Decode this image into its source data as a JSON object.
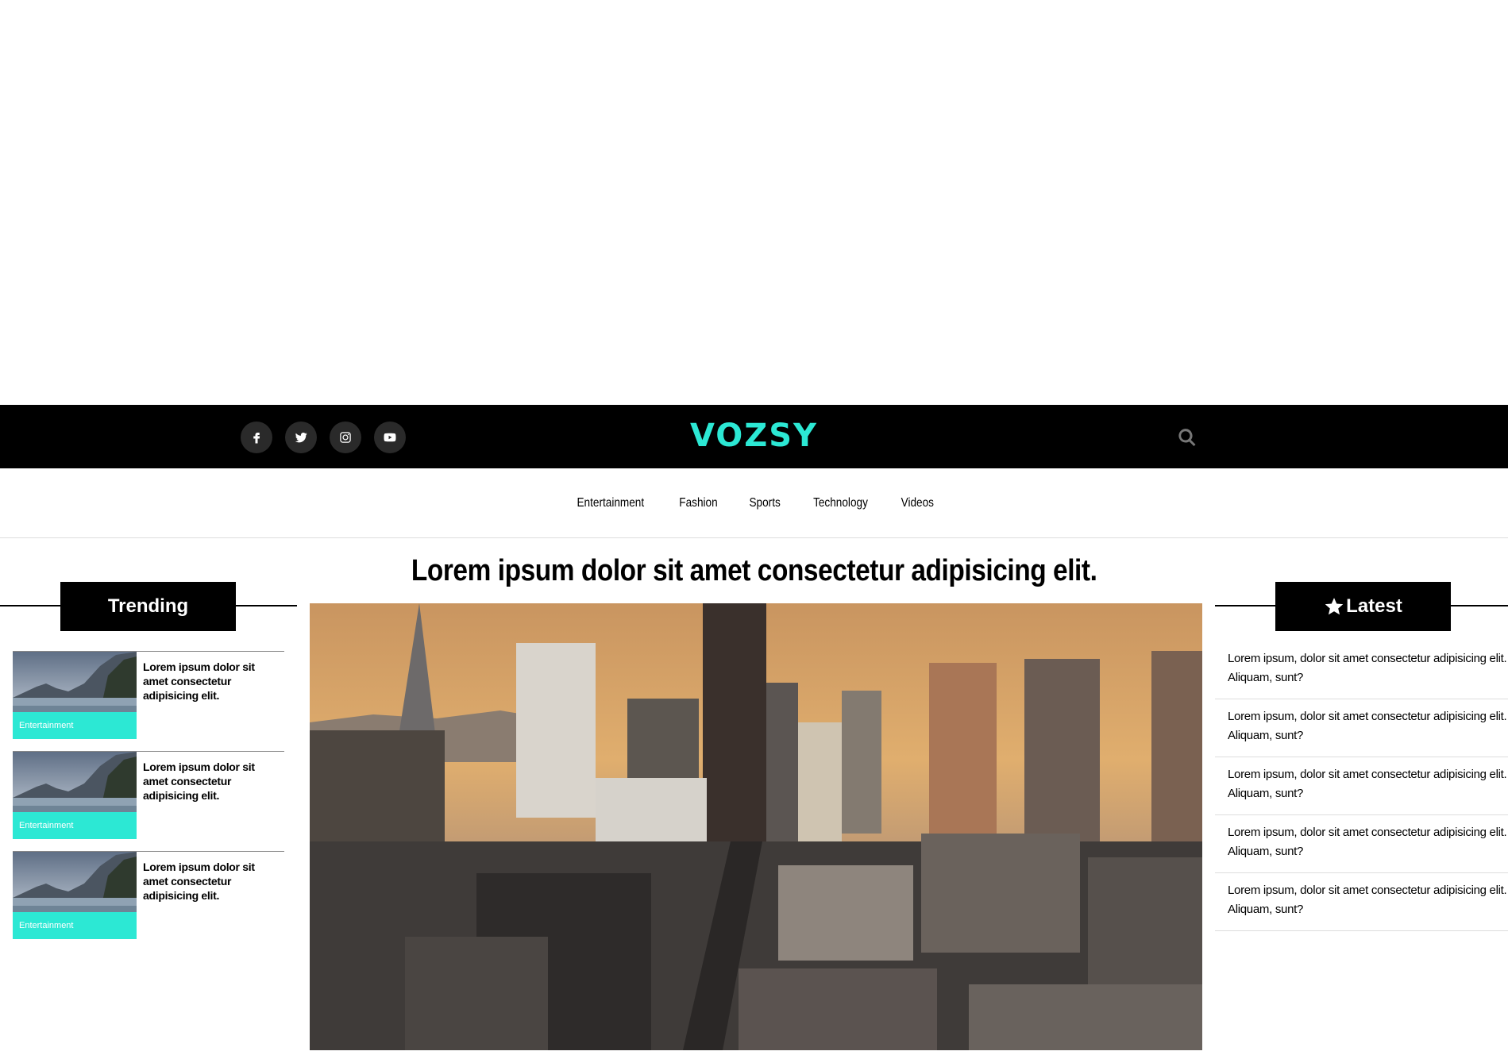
{
  "brand": {
    "name": "VOZSY",
    "accent_color": "#2ce8d4"
  },
  "socials": [
    {
      "icon": "facebook-icon"
    },
    {
      "icon": "twitter-icon"
    },
    {
      "icon": "instagram-icon"
    },
    {
      "icon": "youtube-icon"
    }
  ],
  "search": {
    "icon": "search-icon"
  },
  "nav": {
    "items": [
      "Entertainment",
      "Fashion",
      "Sports",
      "Technology",
      "Videos"
    ]
  },
  "main": {
    "headline": "Lorem ipsum dolor sit amet consectetur adipisicing elit.",
    "hero_image": "city-skyline-sunset-image"
  },
  "trending": {
    "title": "Trending",
    "items": [
      {
        "title": "Lorem ipsum dolor sit amet consectetur adipisicing elit.",
        "tag": "Entertainment"
      },
      {
        "title": "Lorem ipsum dolor sit amet consectetur adipisicing elit.",
        "tag": "Entertainment"
      },
      {
        "title": "Lorem ipsum dolor sit amet consectetur adipisicing elit.",
        "tag": "Entertainment"
      }
    ]
  },
  "latest": {
    "title": "Latest",
    "icon": "star-icon",
    "items": [
      {
        "title": "Lorem ipsum, dolor sit amet consectetur adipisicing elit. Aliquam, sunt?"
      },
      {
        "title": "Lorem ipsum, dolor sit amet consectetur adipisicing elit. Aliquam, sunt?"
      },
      {
        "title": "Lorem ipsum, dolor sit amet consectetur adipisicing elit. Aliquam, sunt?"
      },
      {
        "title": "Lorem ipsum, dolor sit amet consectetur adipisicing elit. Aliquam, sunt?"
      },
      {
        "title": "Lorem ipsum, dolor sit amet consectetur adipisicing elit. Aliquam, sunt?"
      }
    ]
  }
}
